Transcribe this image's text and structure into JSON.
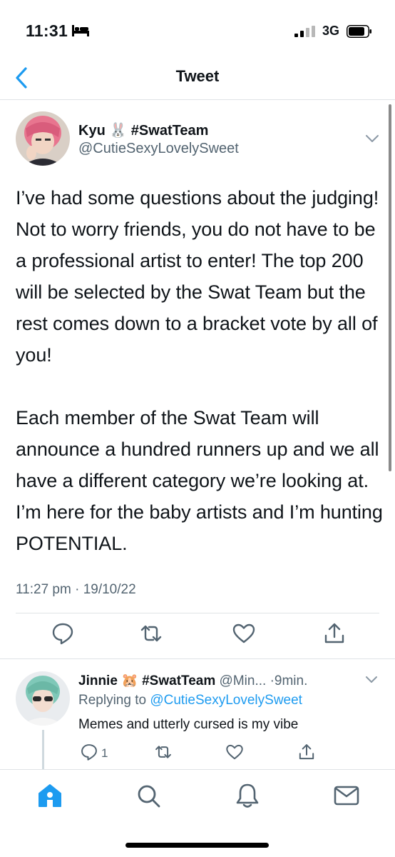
{
  "status_bar": {
    "time": "11:31",
    "network": "3G"
  },
  "nav": {
    "title": "Tweet"
  },
  "tweet": {
    "author_name": "Kyu 🐰 #SwatTeam",
    "author_handle": "@CutieSexyLovelySweet",
    "text": "I’ve had some questions about the judging! Not to worry friends, you do not have to be a professional artist to enter! The top 200 will be selected by the Swat Team but the rest comes down to a bracket vote by all of you!\n\nEach member of the Swat Team will announce a hundred runners up and we all have a different category we’re looking at. I’m here for the baby artists and I’m hunting POTENTIAL.",
    "timestamp": "11:27 pm · 19/10/22"
  },
  "reply": {
    "author_name": "Jinnie 🐹 #SwatTeam",
    "author_handle": "@Min...",
    "time": "·9min.",
    "replying_prefix": "Replying to ",
    "replying_to": "@CutieSexyLovelySweet",
    "text": "Memes and utterly cursed is my vibe",
    "reply_count": "1"
  },
  "colors": {
    "accent": "#1d9bf0",
    "secondary_text": "#536471",
    "icon_gray": "#536471",
    "divider": "#dfe3e6"
  },
  "icons": {
    "actions": [
      "reply-icon",
      "retweet-icon",
      "like-icon",
      "share-icon"
    ],
    "tabs": [
      "home-icon",
      "search-icon",
      "notifications-icon",
      "messages-icon"
    ]
  }
}
